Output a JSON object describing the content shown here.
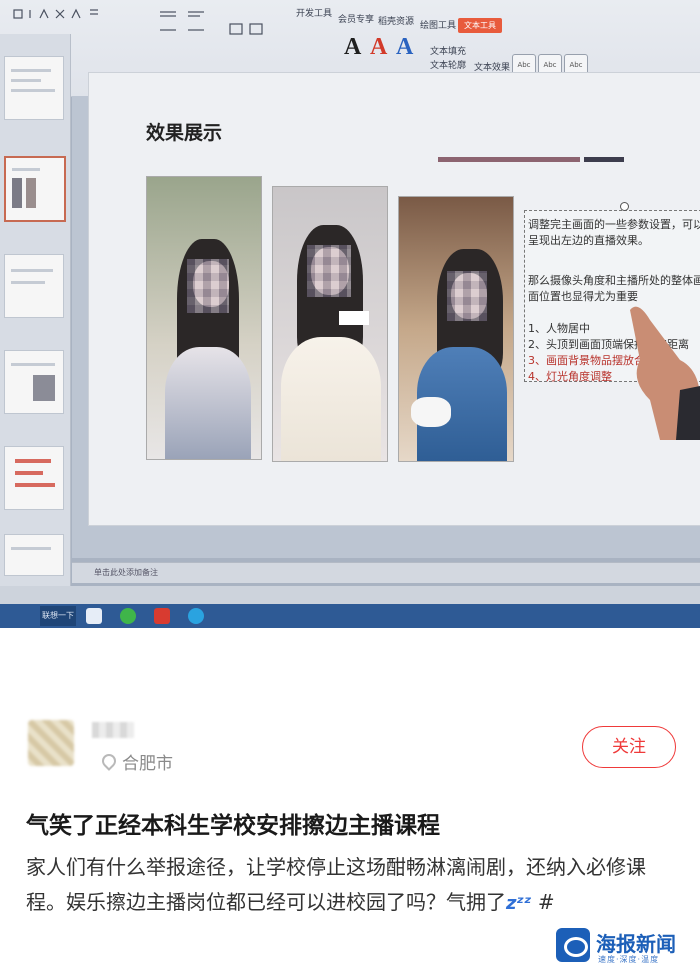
{
  "screen": {
    "ribbon": {
      "tabs": [
        "开发工具",
        "会员专享",
        "稻壳资源",
        "绘图工具",
        "文本工具"
      ],
      "active_tab": "文本工具",
      "big_a_labels": [
        "A",
        "A",
        "A"
      ],
      "tools": [
        "文本填充",
        "文本轮廓",
        "文本效果"
      ]
    },
    "slide": {
      "title": "效果展示",
      "textbox_lines": [
        "调整完主画面的一些参数设置，可以",
        "呈现出左边的直播效果。",
        "那么摄像头角度和主播所处的整体画",
        "面位置也显得尤为重要",
        "1、人物居中",
        "2、头顶到画面顶端保持一定距离",
        "3、画面背景物品摆放合理",
        "4、灯光角度调整"
      ]
    },
    "status_note": "单击此处添加备注",
    "taskbar_start": "联想一下"
  },
  "post": {
    "location": "合肥市",
    "follow_label": "关注",
    "title": "气笑了正经本科生学校安排擦边主播课程",
    "body": "家人们有什么举报途径，让学校停止这场酣畅淋漓闹剧，还纳入必修课程。娱乐擦边主播岗位都已经可以进校园了吗？气拥了",
    "zzz": "zᶻᶻ",
    "hashtag": "#"
  },
  "watermark": {
    "name": "海报新闻",
    "sub": "速度·深度·温度"
  },
  "colors": {
    "follow": "#ef3a3a",
    "watermark": "#1c5fb8",
    "ribbon_active": "#e85b3c"
  }
}
